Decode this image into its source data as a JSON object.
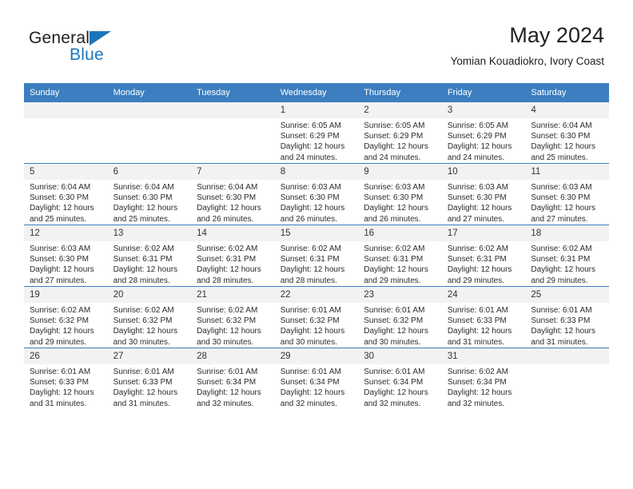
{
  "brand": {
    "name_top": "General",
    "name_bottom": "Blue",
    "accent_color": "#1b75bb"
  },
  "header": {
    "title": "May 2024",
    "subtitle": "Yomian Kouadiokro, Ivory Coast"
  },
  "theme": {
    "header_bg": "#3c7ebf",
    "daynum_bg": "#f2f2f2",
    "text": "#2b2b2b"
  },
  "calendar": {
    "weekday_headers": [
      "Sunday",
      "Monday",
      "Tuesday",
      "Wednesday",
      "Thursday",
      "Friday",
      "Saturday"
    ],
    "weeks": [
      [
        {
          "day": "",
          "empty": true
        },
        {
          "day": "",
          "empty": true
        },
        {
          "day": "",
          "empty": true
        },
        {
          "day": "1",
          "sunrise": "Sunrise: 6:05 AM",
          "sunset": "Sunset: 6:29 PM",
          "daylight1": "Daylight: 12 hours",
          "daylight2": "and 24 minutes."
        },
        {
          "day": "2",
          "sunrise": "Sunrise: 6:05 AM",
          "sunset": "Sunset: 6:29 PM",
          "daylight1": "Daylight: 12 hours",
          "daylight2": "and 24 minutes."
        },
        {
          "day": "3",
          "sunrise": "Sunrise: 6:05 AM",
          "sunset": "Sunset: 6:29 PM",
          "daylight1": "Daylight: 12 hours",
          "daylight2": "and 24 minutes."
        },
        {
          "day": "4",
          "sunrise": "Sunrise: 6:04 AM",
          "sunset": "Sunset: 6:30 PM",
          "daylight1": "Daylight: 12 hours",
          "daylight2": "and 25 minutes."
        }
      ],
      [
        {
          "day": "5",
          "sunrise": "Sunrise: 6:04 AM",
          "sunset": "Sunset: 6:30 PM",
          "daylight1": "Daylight: 12 hours",
          "daylight2": "and 25 minutes."
        },
        {
          "day": "6",
          "sunrise": "Sunrise: 6:04 AM",
          "sunset": "Sunset: 6:30 PM",
          "daylight1": "Daylight: 12 hours",
          "daylight2": "and 25 minutes."
        },
        {
          "day": "7",
          "sunrise": "Sunrise: 6:04 AM",
          "sunset": "Sunset: 6:30 PM",
          "daylight1": "Daylight: 12 hours",
          "daylight2": "and 26 minutes."
        },
        {
          "day": "8",
          "sunrise": "Sunrise: 6:03 AM",
          "sunset": "Sunset: 6:30 PM",
          "daylight1": "Daylight: 12 hours",
          "daylight2": "and 26 minutes."
        },
        {
          "day": "9",
          "sunrise": "Sunrise: 6:03 AM",
          "sunset": "Sunset: 6:30 PM",
          "daylight1": "Daylight: 12 hours",
          "daylight2": "and 26 minutes."
        },
        {
          "day": "10",
          "sunrise": "Sunrise: 6:03 AM",
          "sunset": "Sunset: 6:30 PM",
          "daylight1": "Daylight: 12 hours",
          "daylight2": "and 27 minutes."
        },
        {
          "day": "11",
          "sunrise": "Sunrise: 6:03 AM",
          "sunset": "Sunset: 6:30 PM",
          "daylight1": "Daylight: 12 hours",
          "daylight2": "and 27 minutes."
        }
      ],
      [
        {
          "day": "12",
          "sunrise": "Sunrise: 6:03 AM",
          "sunset": "Sunset: 6:30 PM",
          "daylight1": "Daylight: 12 hours",
          "daylight2": "and 27 minutes."
        },
        {
          "day": "13",
          "sunrise": "Sunrise: 6:02 AM",
          "sunset": "Sunset: 6:31 PM",
          "daylight1": "Daylight: 12 hours",
          "daylight2": "and 28 minutes."
        },
        {
          "day": "14",
          "sunrise": "Sunrise: 6:02 AM",
          "sunset": "Sunset: 6:31 PM",
          "daylight1": "Daylight: 12 hours",
          "daylight2": "and 28 minutes."
        },
        {
          "day": "15",
          "sunrise": "Sunrise: 6:02 AM",
          "sunset": "Sunset: 6:31 PM",
          "daylight1": "Daylight: 12 hours",
          "daylight2": "and 28 minutes."
        },
        {
          "day": "16",
          "sunrise": "Sunrise: 6:02 AM",
          "sunset": "Sunset: 6:31 PM",
          "daylight1": "Daylight: 12 hours",
          "daylight2": "and 29 minutes."
        },
        {
          "day": "17",
          "sunrise": "Sunrise: 6:02 AM",
          "sunset": "Sunset: 6:31 PM",
          "daylight1": "Daylight: 12 hours",
          "daylight2": "and 29 minutes."
        },
        {
          "day": "18",
          "sunrise": "Sunrise: 6:02 AM",
          "sunset": "Sunset: 6:31 PM",
          "daylight1": "Daylight: 12 hours",
          "daylight2": "and 29 minutes."
        }
      ],
      [
        {
          "day": "19",
          "sunrise": "Sunrise: 6:02 AM",
          "sunset": "Sunset: 6:32 PM",
          "daylight1": "Daylight: 12 hours",
          "daylight2": "and 29 minutes."
        },
        {
          "day": "20",
          "sunrise": "Sunrise: 6:02 AM",
          "sunset": "Sunset: 6:32 PM",
          "daylight1": "Daylight: 12 hours",
          "daylight2": "and 30 minutes."
        },
        {
          "day": "21",
          "sunrise": "Sunrise: 6:02 AM",
          "sunset": "Sunset: 6:32 PM",
          "daylight1": "Daylight: 12 hours",
          "daylight2": "and 30 minutes."
        },
        {
          "day": "22",
          "sunrise": "Sunrise: 6:01 AM",
          "sunset": "Sunset: 6:32 PM",
          "daylight1": "Daylight: 12 hours",
          "daylight2": "and 30 minutes."
        },
        {
          "day": "23",
          "sunrise": "Sunrise: 6:01 AM",
          "sunset": "Sunset: 6:32 PM",
          "daylight1": "Daylight: 12 hours",
          "daylight2": "and 30 minutes."
        },
        {
          "day": "24",
          "sunrise": "Sunrise: 6:01 AM",
          "sunset": "Sunset: 6:33 PM",
          "daylight1": "Daylight: 12 hours",
          "daylight2": "and 31 minutes."
        },
        {
          "day": "25",
          "sunrise": "Sunrise: 6:01 AM",
          "sunset": "Sunset: 6:33 PM",
          "daylight1": "Daylight: 12 hours",
          "daylight2": "and 31 minutes."
        }
      ],
      [
        {
          "day": "26",
          "sunrise": "Sunrise: 6:01 AM",
          "sunset": "Sunset: 6:33 PM",
          "daylight1": "Daylight: 12 hours",
          "daylight2": "and 31 minutes."
        },
        {
          "day": "27",
          "sunrise": "Sunrise: 6:01 AM",
          "sunset": "Sunset: 6:33 PM",
          "daylight1": "Daylight: 12 hours",
          "daylight2": "and 31 minutes."
        },
        {
          "day": "28",
          "sunrise": "Sunrise: 6:01 AM",
          "sunset": "Sunset: 6:34 PM",
          "daylight1": "Daylight: 12 hours",
          "daylight2": "and 32 minutes."
        },
        {
          "day": "29",
          "sunrise": "Sunrise: 6:01 AM",
          "sunset": "Sunset: 6:34 PM",
          "daylight1": "Daylight: 12 hours",
          "daylight2": "and 32 minutes."
        },
        {
          "day": "30",
          "sunrise": "Sunrise: 6:01 AM",
          "sunset": "Sunset: 6:34 PM",
          "daylight1": "Daylight: 12 hours",
          "daylight2": "and 32 minutes."
        },
        {
          "day": "31",
          "sunrise": "Sunrise: 6:02 AM",
          "sunset": "Sunset: 6:34 PM",
          "daylight1": "Daylight: 12 hours",
          "daylight2": "and 32 minutes."
        },
        {
          "day": "",
          "empty": true
        }
      ]
    ]
  }
}
